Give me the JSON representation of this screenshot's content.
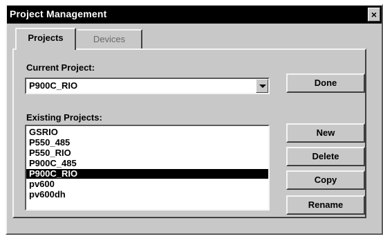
{
  "window": {
    "title": "Project Management"
  },
  "tabs": [
    {
      "label": "Projects",
      "active": true
    },
    {
      "label": "Devices",
      "active": false
    }
  ],
  "current_project": {
    "label": "Current Project:",
    "value": "P900C_RIO"
  },
  "existing_projects": {
    "label": "Existing Projects:",
    "items": [
      "GSRIO",
      "P550_485",
      "P550_RIO",
      "P900C_485",
      "P900C_RIO",
      "pv600",
      "pv600dh"
    ],
    "selected": "P900C_RIO"
  },
  "buttons": {
    "done": "Done",
    "new": "New",
    "delete": "Delete",
    "copy": "Copy",
    "rename": "Rename"
  },
  "colors": {
    "face": "#c8c8c8",
    "titlebar": "#000000",
    "selection": "#000000"
  }
}
